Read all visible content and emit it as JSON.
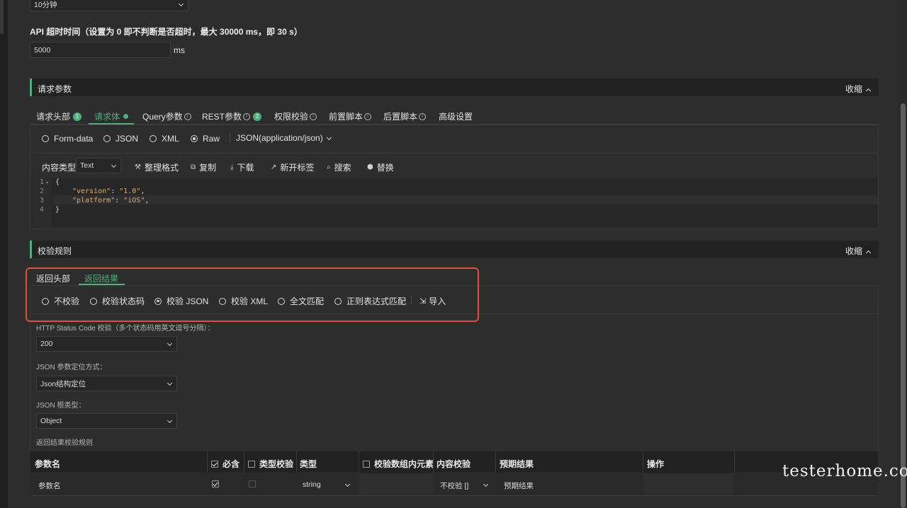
{
  "top": {
    "interval_value": "10分钟",
    "api_timeout_label": "API 超时时间（设置为 0 即不判断是否超时，最大 30000 ms，即 30 s）",
    "api_timeout_value": "5000",
    "api_timeout_unit": "ms"
  },
  "request": {
    "section_title": "请求参数",
    "collapse_label": "收缩",
    "tabs": {
      "headers": "请求头部",
      "headers_badge": "1",
      "body": "请求体",
      "query": "Query参数",
      "rest": "REST参数",
      "rest_badge": "2",
      "auth": "权限校验",
      "pre_script": "前置脚本",
      "post_script": "后置脚本",
      "advanced": "高级设置"
    },
    "body_types": [
      "Form-data",
      "JSON",
      "XML",
      "Raw"
    ],
    "raw_type": "JSON(application/json)",
    "content_type_label": "内容类型",
    "content_type_value": "Text",
    "toolbar": {
      "format": "整理格式",
      "copy": "复制",
      "download": "下载",
      "new_tab": "新开标签",
      "search": "搜索",
      "replace": "替换"
    },
    "code": {
      "line1": "{",
      "line2_key": "\"version\"",
      "line2_val": "\"1.0\"",
      "line3_key": "\"platform\"",
      "line3_val": "\"iOS\"",
      "line4": "}",
      "numbers": [
        "1",
        "2",
        "3",
        "4"
      ]
    }
  },
  "validation": {
    "section_title": "校验规则",
    "collapse_label": "收缩",
    "tabs": {
      "headers": "返回头部",
      "result": "返回结果"
    },
    "modes": [
      "不校验",
      "校验状态码",
      "校验 JSON",
      "校验 XML",
      "全文匹配",
      "正则表达式匹配"
    ],
    "import_label": "导入",
    "status_code_label": "HTTP Status Code 校验（多个状态码用英文逗号分隔）：",
    "status_code_value": "200",
    "json_locate_label": "JSON 参数定位方式：",
    "json_locate_value": "Json结构定位",
    "json_root_label": "JSON 根类型：",
    "json_root_value": "Object",
    "rules_label": "返回结果校验规则",
    "table": {
      "headers": {
        "param": "参数名",
        "required": "必含",
        "type_check": "类型校验",
        "type": "类型",
        "array_check": "校验数组内元素",
        "content_check": "内容校验",
        "expected": "预期结果",
        "action": "操作"
      },
      "row": {
        "param": "参数名",
        "type": "string",
        "content_check": "不校验 []",
        "expected": "预期结果"
      }
    }
  },
  "watermark": "testerhome.com"
}
